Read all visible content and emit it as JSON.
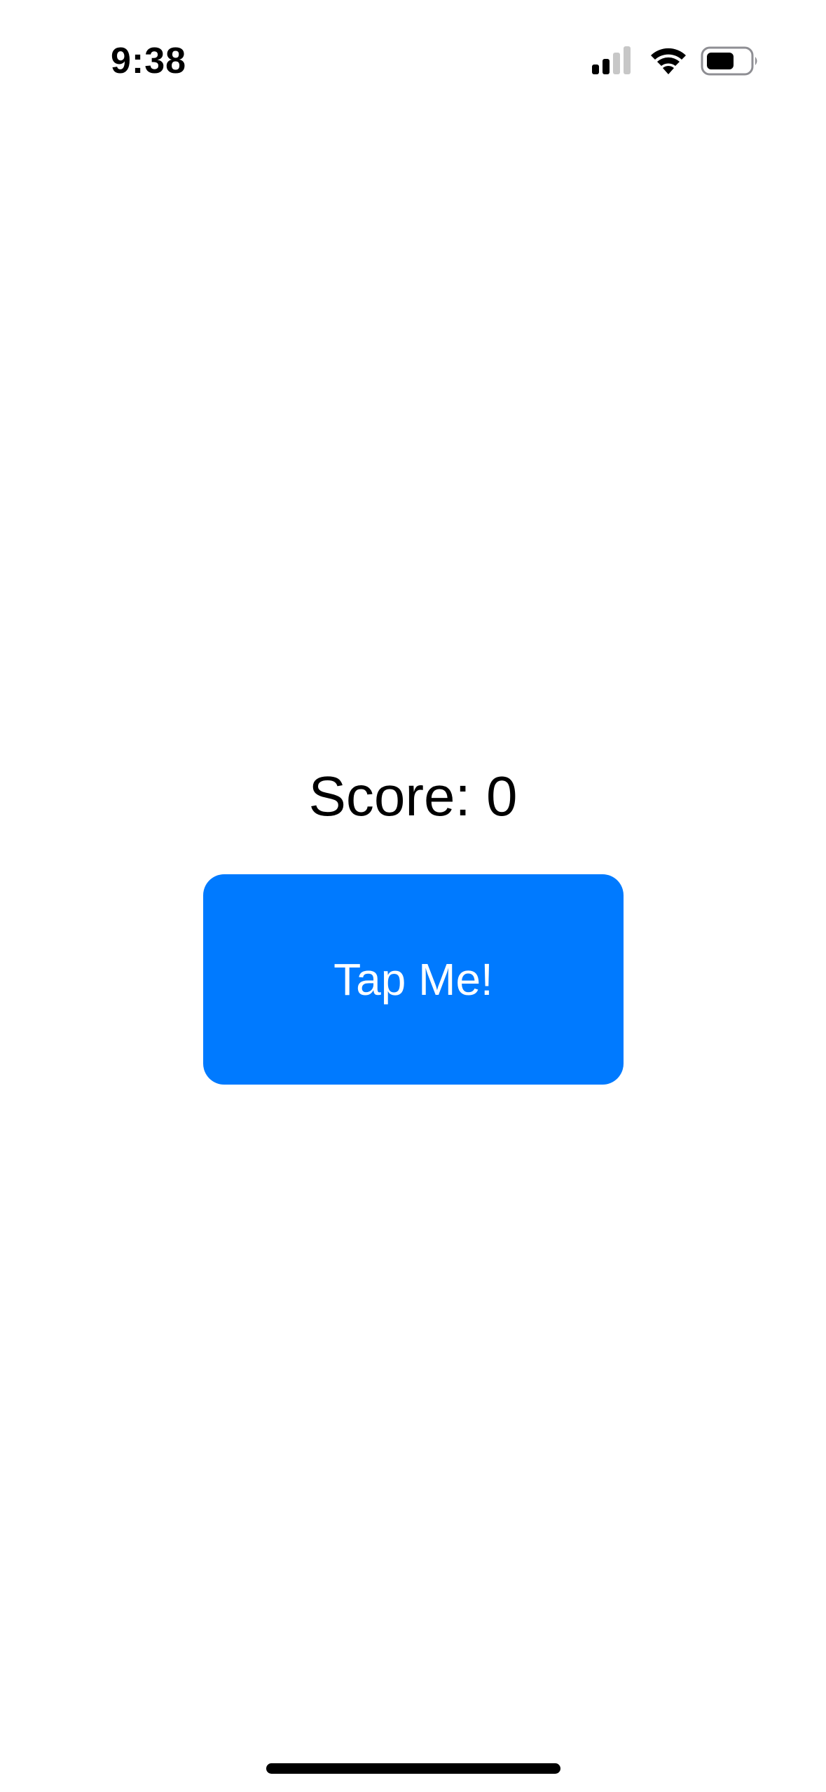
{
  "status_bar": {
    "time": "9:38",
    "signal_icon": "cellular-signal-icon",
    "wifi_icon": "wifi-icon",
    "battery_icon": "battery-icon"
  },
  "main": {
    "score_text": "Score: 0",
    "button_label": "Tap Me!"
  },
  "colors": {
    "accent": "#007AFF",
    "background": "#FFFFFF",
    "text": "#000000"
  }
}
